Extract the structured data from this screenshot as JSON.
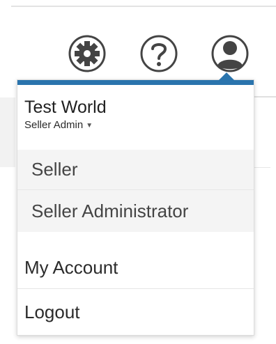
{
  "header": {
    "icons": {
      "settings": "gear-icon",
      "help": "question-mark-icon",
      "profile": "user-avatar-icon"
    }
  },
  "dropdown": {
    "accent_color": "#2a74ad",
    "company_name": "Test World",
    "current_role": "Seller Admin",
    "roles": [
      "Seller",
      "Seller Administrator"
    ],
    "menu": [
      "My Account",
      "Logout"
    ]
  }
}
